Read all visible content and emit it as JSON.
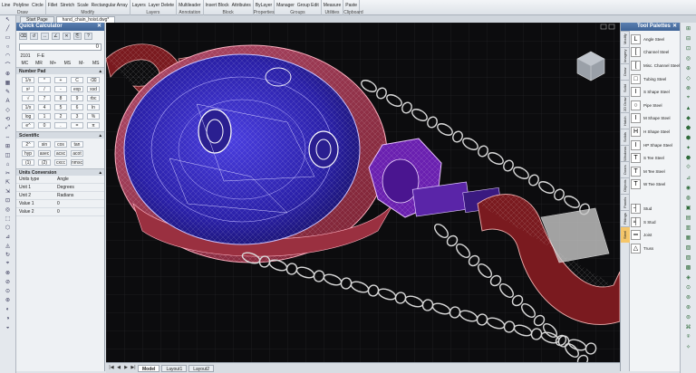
{
  "ribbon": {
    "groups": [
      {
        "label": "Draw",
        "items": [
          "Line",
          "Polyline",
          "Circle"
        ]
      },
      {
        "label": "Modify",
        "items": [
          "Fillet",
          "Stretch",
          "Scale",
          "Rectangular Array"
        ]
      },
      {
        "label": "Layers",
        "items": [
          "Layers",
          "Layer Delete"
        ]
      },
      {
        "label": "Annotation",
        "items": [
          "Multileader"
        ]
      },
      {
        "label": "Block",
        "items": [
          "Insert Block",
          "Attributes"
        ]
      },
      {
        "label": "Properties",
        "items": [
          "ByLayer"
        ]
      },
      {
        "label": "Groups",
        "items": [
          "Manager",
          "Group Edit"
        ]
      },
      {
        "label": "Utilities",
        "items": [
          "Measure"
        ]
      },
      {
        "label": "Clipboard",
        "items": [
          "Paste"
        ]
      }
    ]
  },
  "tabs": {
    "start": "Start Page",
    "document": "hand_chain_hoist.dwg*"
  },
  "left_tools": [
    "↖",
    "╱",
    "▭",
    "○",
    "◠",
    "⌒",
    "⊕",
    "▦",
    "✎",
    "A",
    "◇",
    "⟲",
    "⤢",
    "⇔",
    "⊞",
    "◫",
    "⌂",
    "✂",
    "⇱",
    "⇲",
    "⊡",
    "◎",
    "⬚",
    "⬡",
    "⊿",
    "◬",
    "↻",
    "⌖",
    "⊗",
    "⊘",
    "⊙",
    "⊛",
    "◐",
    "◑",
    "◒"
  ],
  "quick_calc": {
    "title": "Quick Calculator",
    "display_value": "0",
    "memory_row1": [
      "2101",
      "F-E"
    ],
    "memory_row2": [
      "MC",
      "MR",
      "M+",
      "MS",
      "M-",
      "MS"
    ],
    "number_pad_title": "Number Pad",
    "number_pad": [
      "1/x",
      "*",
      "+",
      "C",
      "⌫",
      "x²",
      "/",
      "-",
      "exp",
      "xsd",
      "√",
      "7",
      "8",
      "9",
      "rbc",
      "1/x",
      "4",
      "5",
      "6",
      "ln",
      "log",
      "1",
      "2",
      "3",
      "%",
      "e^",
      "0",
      ".",
      "=",
      "π"
    ],
    "scientific_title": "Scientific",
    "scientific": [
      "2^",
      "sin",
      "cos",
      "tan",
      "hyp",
      "asec",
      "acsc",
      "acot",
      "(1)",
      "(2)",
      "cxcc",
      "nmsc"
    ],
    "units_title": "Units Conversion",
    "units": [
      {
        "key": "Units type",
        "value": "Angle"
      },
      {
        "key": "Unit 1",
        "value": "Degrees"
      },
      {
        "key": "Unit 2",
        "value": "Radians"
      },
      {
        "key": "Value 1",
        "value": "0"
      },
      {
        "key": "Value 2",
        "value": "0"
      }
    ]
  },
  "layout_tabs": {
    "nav": [
      "|◀",
      "◀",
      "▶",
      "▶|"
    ],
    "tabs": [
      "Model",
      "Layout1",
      "Layout2"
    ]
  },
  "palettes": {
    "title": "Tool Palettes",
    "side_tabs": [
      "Modify",
      "Imagery",
      "Draw",
      "Solid",
      "2D Draw",
      "Hatch",
      "Solids",
      "Windows",
      "Doors",
      "Objects",
      "Panels",
      "Fittings",
      "Steel"
    ],
    "items": [
      "Angle Steel",
      "Channel Steel",
      "Misc. Channel Steel",
      "Tubing Steel",
      "S Shape Steel",
      "Pipe Steel",
      "M Shape Steel",
      "H Shape Steel",
      "HP Shape Steel",
      "S Tee Steel",
      "M Tee Steel",
      "W Tee Steel"
    ],
    "items2": [
      "Stud",
      "S Stud",
      "Joist",
      "Truss"
    ],
    "item_icons": [
      "L",
      "[",
      "[",
      "□",
      "I",
      "○",
      "I",
      "H",
      "I",
      "T",
      "T",
      "T"
    ],
    "item2_icons": [
      "┤",
      "╡",
      "═",
      "△"
    ]
  },
  "right_tools": [
    "⊞",
    "⊟",
    "⊡",
    "◎",
    "⊕",
    "◇",
    "⊗",
    "⌖",
    "▲",
    "◆",
    "⬟",
    "⬢",
    "✦",
    "⬣",
    "⟐",
    "⊿",
    "◉",
    "◍",
    "▣",
    "▤",
    "▥",
    "▦",
    "▧",
    "▨",
    "▩",
    "◈",
    "⊙",
    "⊚",
    "⊛",
    "⊜",
    "⌘",
    "⍟",
    "✧"
  ],
  "colors": {
    "ribbon_bg": "#e8ecf0",
    "panel_title": "#4a6fa5",
    "viewport_bg": "#0c0c0e",
    "housing_fill": "#3327c7",
    "chain_stroke": "#d9d9d9",
    "hook_fill": "#7a1a1f",
    "hub_fill": "#6a20b0",
    "active_palette_tab": "#f5c66a"
  }
}
